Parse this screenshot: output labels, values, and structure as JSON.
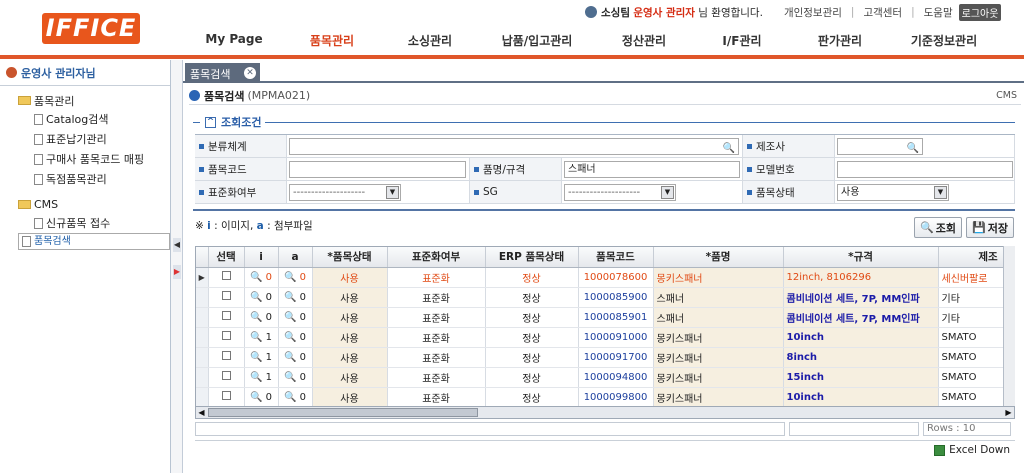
{
  "header": {
    "logo": "IFFICE",
    "welcome_user": "소싱팀",
    "welcome_role": "운영사 관리자",
    "welcome_suffix": "님 환영합니다.",
    "links": [
      "개인정보관리",
      "고객센터",
      "도움말"
    ],
    "logout": "로그아웃",
    "nav": [
      "My Page",
      "품목관리",
      "소싱관리",
      "납품/입고관리",
      "정산관리",
      "I/F관리",
      "판가관리",
      "기준정보관리"
    ],
    "active_nav": "품목관리"
  },
  "sidebar": {
    "title": "운영사 관리자님",
    "groups": [
      {
        "label": "품목관리",
        "items": [
          "Catalog검색",
          "표준납기관리",
          "구매사 품목코드 매핑",
          "독점품목관리"
        ]
      },
      {
        "label": "CMS",
        "items": [
          "신규품목 접수",
          "품목검색"
        ]
      }
    ],
    "selected": "품목검색"
  },
  "tab": {
    "label": "품목검색"
  },
  "page": {
    "title": "품목검색",
    "code": "(MPMA021)",
    "right": "CMS"
  },
  "search": {
    "section_label": "조회조건",
    "fields": {
      "category": {
        "label": "분류체계",
        "value": ""
      },
      "maker": {
        "label": "제조사",
        "value": ""
      },
      "item_code": {
        "label": "품목코드",
        "value": ""
      },
      "item_name": {
        "label": "품명/규격",
        "value": "스패너"
      },
      "model": {
        "label": "모델번호",
        "value": ""
      },
      "std": {
        "label": "표준화여부",
        "value": "--------------------"
      },
      "sg": {
        "label": "SG",
        "value": "--------------------"
      },
      "status": {
        "label": "품목상태",
        "value": "사용"
      }
    }
  },
  "legend": {
    "prefix": "※",
    "i_key": "i",
    "i_text": ": 이미지,",
    "a_key": "a",
    "a_text": ": 첨부파일"
  },
  "buttons": {
    "search": "조회",
    "save": "저장"
  },
  "grid": {
    "columns": [
      "선택",
      "i",
      "a",
      "*품목상태",
      "표준화여부",
      "ERP 품목상태",
      "품목코드",
      "*품명",
      "*규격",
      "제조"
    ],
    "rows": [
      {
        "i": "0",
        "a": "0",
        "status": "사용",
        "std": "표준화",
        "erp": "정상",
        "code": "1000078600",
        "name": "몽키스패너",
        "spec": "12inch, 8106296",
        "maker": "세신버팔로"
      },
      {
        "i": "0",
        "a": "0",
        "status": "사용",
        "std": "표준화",
        "erp": "정상",
        "code": "1000085900",
        "name": "스패너",
        "spec": "콤비네이션 세트, 7P, MM인파",
        "maker": "기타"
      },
      {
        "i": "0",
        "a": "0",
        "status": "사용",
        "std": "표준화",
        "erp": "정상",
        "code": "1000085901",
        "name": "스패너",
        "spec": "콤비네이션 세트, 7P, MM인파",
        "maker": "기타"
      },
      {
        "i": "1",
        "a": "0",
        "status": "사용",
        "std": "표준화",
        "erp": "정상",
        "code": "1000091000",
        "name": "몽키스패너",
        "spec": "10inch",
        "maker": "SMATO"
      },
      {
        "i": "1",
        "a": "0",
        "status": "사용",
        "std": "표준화",
        "erp": "정상",
        "code": "1000091700",
        "name": "몽키스패너",
        "spec": "8inch",
        "maker": "SMATO"
      },
      {
        "i": "1",
        "a": "0",
        "status": "사용",
        "std": "표준화",
        "erp": "정상",
        "code": "1000094800",
        "name": "몽키스패너",
        "spec": "15inch",
        "maker": "SMATO"
      },
      {
        "i": "0",
        "a": "0",
        "status": "사용",
        "std": "표준화",
        "erp": "정상",
        "code": "1000099800",
        "name": "몽키스패너",
        "spec": "10inch",
        "maker": "SMATO"
      }
    ]
  },
  "status_bar": {
    "rows": "Rows : 10"
  },
  "excel": "Excel Down"
}
